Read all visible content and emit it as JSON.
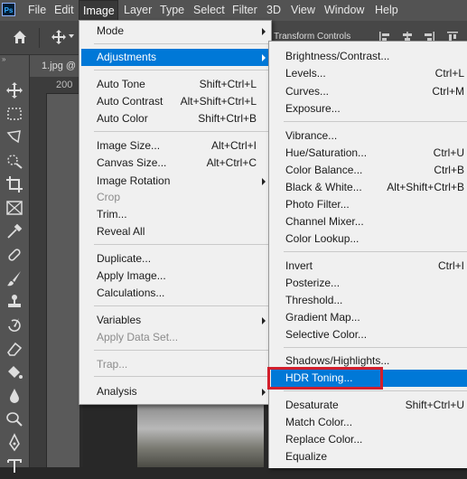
{
  "menubar": {
    "logo": "Ps",
    "items": [
      "File",
      "Edit",
      "Image",
      "Layer",
      "Type",
      "Select",
      "Filter",
      "3D",
      "View",
      "Window",
      "Help"
    ],
    "active": "Image"
  },
  "options_bar": {
    "transform_label": "Transform Controls"
  },
  "document": {
    "tab_label": "1.jpg @",
    "ruler_value": "200"
  },
  "image_menu": {
    "items": [
      {
        "label": "Mode",
        "shortcut": "",
        "submenu": true
      },
      {
        "label": "Adjustments",
        "shortcut": "",
        "submenu": true,
        "highlight": true
      },
      {
        "label": "Auto Tone",
        "shortcut": "Shift+Ctrl+L"
      },
      {
        "label": "Auto Contrast",
        "shortcut": "Alt+Shift+Ctrl+L"
      },
      {
        "label": "Auto Color",
        "shortcut": "Shift+Ctrl+B"
      },
      {
        "label": "Image Size...",
        "shortcut": "Alt+Ctrl+I"
      },
      {
        "label": "Canvas Size...",
        "shortcut": "Alt+Ctrl+C"
      },
      {
        "label": "Image Rotation",
        "shortcut": "",
        "submenu": true
      },
      {
        "label": "Crop",
        "shortcut": "",
        "disabled": true
      },
      {
        "label": "Trim...",
        "shortcut": ""
      },
      {
        "label": "Reveal All",
        "shortcut": ""
      },
      {
        "label": "Duplicate...",
        "shortcut": ""
      },
      {
        "label": "Apply Image...",
        "shortcut": ""
      },
      {
        "label": "Calculations...",
        "shortcut": ""
      },
      {
        "label": "Variables",
        "shortcut": "",
        "submenu": true
      },
      {
        "label": "Apply Data Set...",
        "shortcut": "",
        "disabled": true
      },
      {
        "label": "Trap...",
        "shortcut": "",
        "disabled": true
      },
      {
        "label": "Analysis",
        "shortcut": "",
        "submenu": true
      }
    ]
  },
  "adjustments_menu": {
    "items": [
      {
        "label": "Brightness/Contrast...",
        "shortcut": ""
      },
      {
        "label": "Levels...",
        "shortcut": "Ctrl+L"
      },
      {
        "label": "Curves...",
        "shortcut": "Ctrl+M"
      },
      {
        "label": "Exposure...",
        "shortcut": ""
      },
      {
        "label": "Vibrance...",
        "shortcut": ""
      },
      {
        "label": "Hue/Saturation...",
        "shortcut": "Ctrl+U"
      },
      {
        "label": "Color Balance...",
        "shortcut": "Ctrl+B"
      },
      {
        "label": "Black & White...",
        "shortcut": "Alt+Shift+Ctrl+B"
      },
      {
        "label": "Photo Filter...",
        "shortcut": ""
      },
      {
        "label": "Channel Mixer...",
        "shortcut": ""
      },
      {
        "label": "Color Lookup...",
        "shortcut": ""
      },
      {
        "label": "Invert",
        "shortcut": "Ctrl+I"
      },
      {
        "label": "Posterize...",
        "shortcut": ""
      },
      {
        "label": "Threshold...",
        "shortcut": ""
      },
      {
        "label": "Gradient Map...",
        "shortcut": ""
      },
      {
        "label": "Selective Color...",
        "shortcut": ""
      },
      {
        "label": "Shadows/Highlights...",
        "shortcut": ""
      },
      {
        "label": "HDR Toning...",
        "shortcut": "",
        "highlight": true,
        "outlined": true
      },
      {
        "label": "Desaturate",
        "shortcut": "Shift+Ctrl+U"
      },
      {
        "label": "Match Color...",
        "shortcut": ""
      },
      {
        "label": "Replace Color...",
        "shortcut": ""
      },
      {
        "label": "Equalize",
        "shortcut": ""
      }
    ]
  },
  "colors": {
    "highlight": "#0078d7",
    "outline": "#d21f2c",
    "menubar": "#535353"
  }
}
